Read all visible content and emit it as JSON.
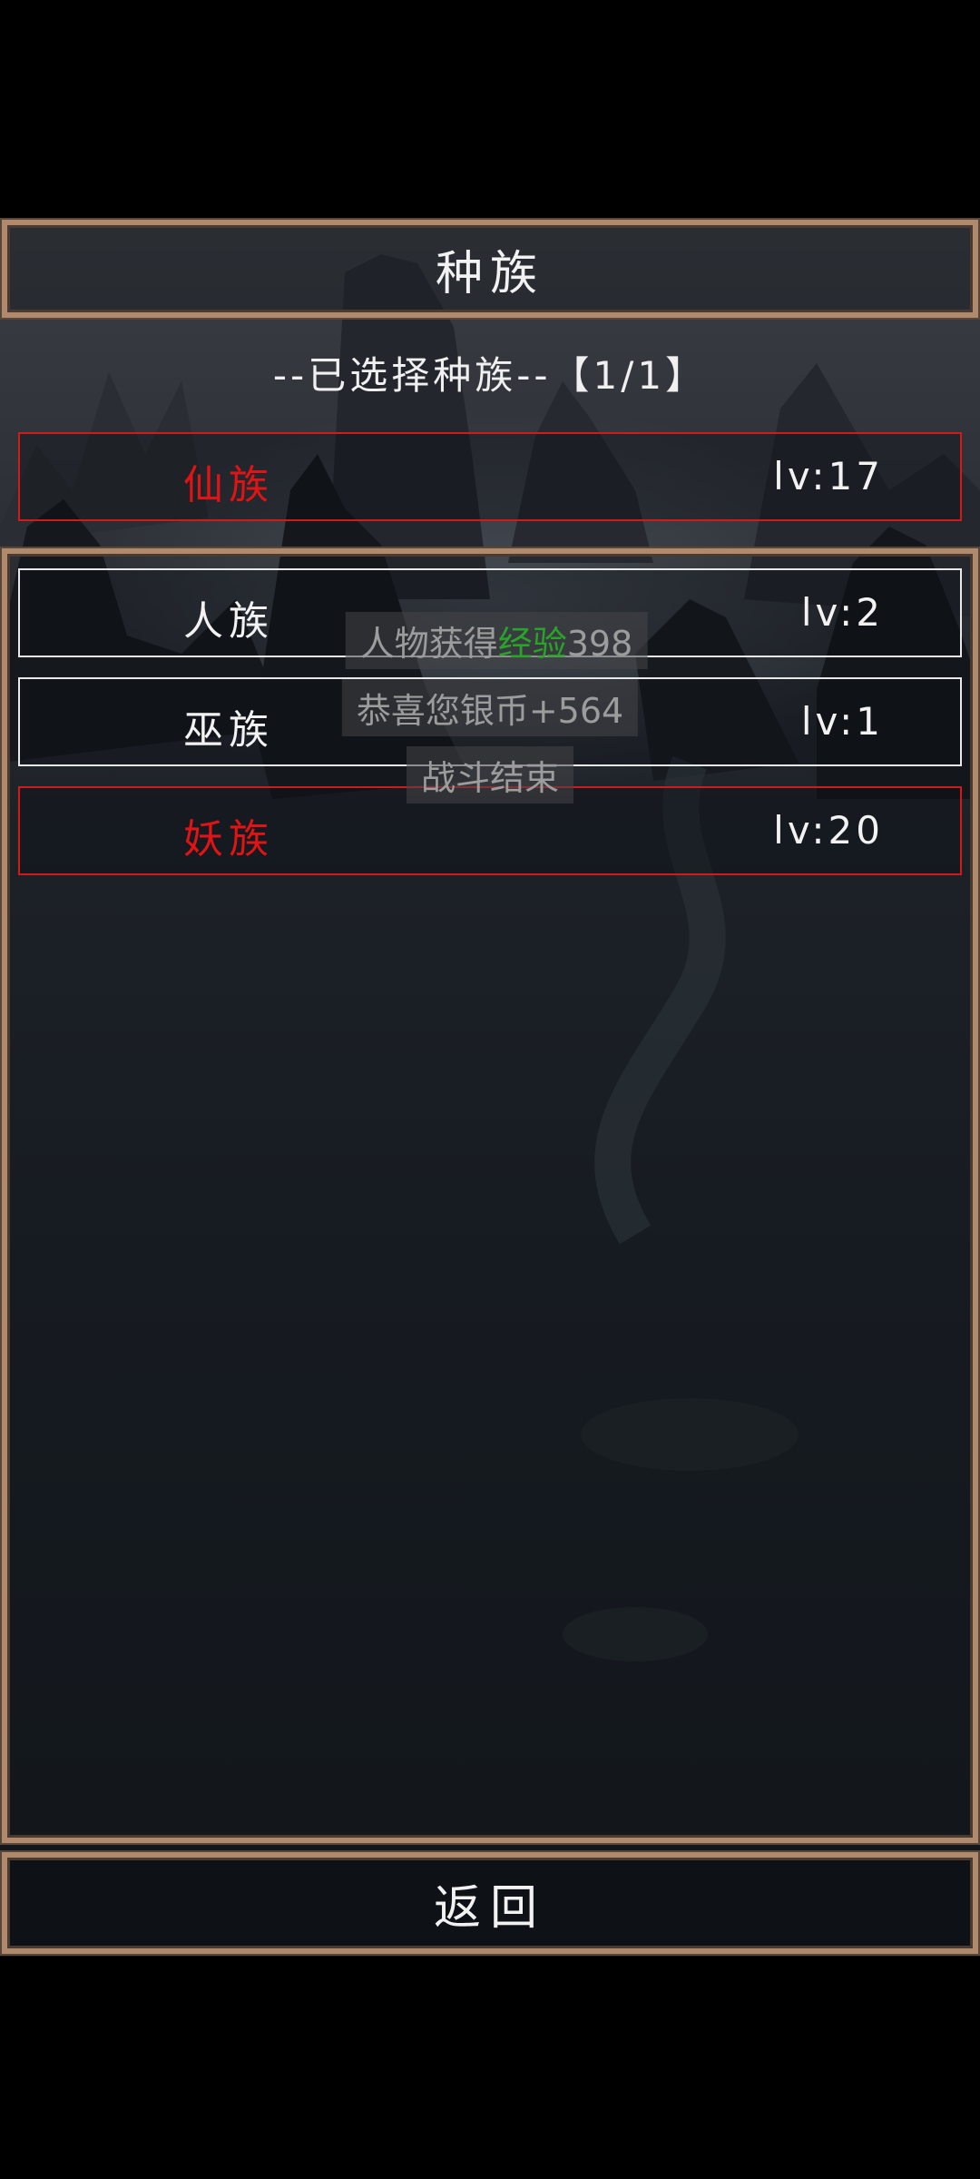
{
  "header": {
    "title": "种族"
  },
  "selection": {
    "label": "--已选择种族--【1/1】"
  },
  "selected_races": [
    {
      "name": "仙族",
      "level": "lv:17",
      "color": "#e01414"
    }
  ],
  "race_list": [
    {
      "name": "人族",
      "level": "lv:2"
    },
    {
      "name": "巫族",
      "level": "lv:1"
    },
    {
      "name": "妖族",
      "level": "lv:20",
      "color": "#e01414"
    }
  ],
  "toasts": {
    "exp_prefix": "人物获得",
    "exp_highlight": "经验",
    "exp_value": "398",
    "silver": "恭喜您银币+564",
    "battle": "战斗结束"
  },
  "footer": {
    "back_label": "返回"
  },
  "colors": {
    "frame": "#b08a6c",
    "selected_border": "#d11a1a",
    "highlight_green": "#2aa32a"
  }
}
